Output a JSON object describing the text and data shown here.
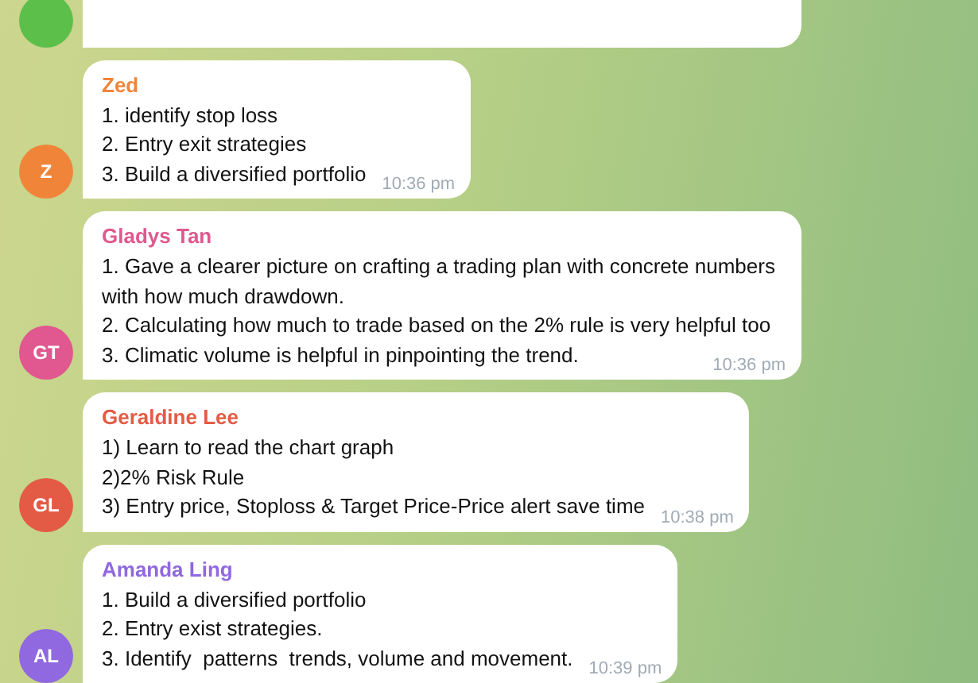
{
  "messages": [
    {
      "color": "#5cbf4a"
    },
    {
      "sender": "Zed",
      "initials": "Z",
      "color": "#f0853a",
      "lines": [
        "1. identify stop loss",
        "2. Entry exit strategies",
        "3. Build a diversified portfolio"
      ],
      "time": "10:36 pm"
    },
    {
      "sender": "Gladys Tan",
      "initials": "GT",
      "color": "#e0588f",
      "lines": [
        "1. Gave a clearer picture on crafting a trading plan with concrete numbers with how much drawdown.",
        "2. Calculating how much to trade based on the 2% rule is very helpful too",
        "3. Climatic volume is helpful in pinpointing the trend."
      ],
      "time": "10:36 pm"
    },
    {
      "sender": "Geraldine Lee",
      "initials": "GL",
      "color": "#e35b45",
      "lines": [
        "1) Learn to read the chart graph",
        "2)2% Risk Rule",
        "3) Entry price, Stoploss & Target Price-Price alert save time"
      ],
      "time": "10:38 pm"
    },
    {
      "sender": "Amanda Ling",
      "initials": "AL",
      "color": "#9068e0",
      "lines": [
        "1. Build a diversified portfolio",
        "2. Entry exist strategies.",
        "3. Identify  patterns  trends, volume and movement."
      ],
      "time": "10:39 pm"
    }
  ]
}
